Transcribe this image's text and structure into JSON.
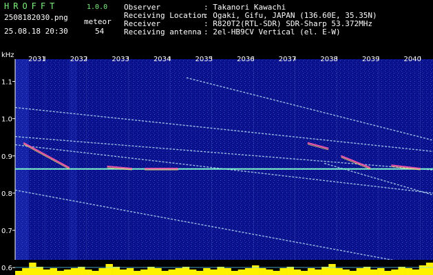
{
  "app": {
    "name": "HROFFT",
    "version": "1.0.0"
  },
  "file": {
    "name": "2508182030.png",
    "timestamp": "25.08.18 20:30"
  },
  "meteor": {
    "label": "meteor",
    "count": "54"
  },
  "info": [
    {
      "label": "Observer",
      "value": ": Takanori Kawachi"
    },
    {
      "label": "Receiving Location",
      "value": ": Ogaki, Gifu, JAPAN (136.60E, 35.35N)"
    },
    {
      "label": "Receiver",
      "value": ": R820T2(RTL-SDR) SDR-Sharp 53.372MHz"
    },
    {
      "label": "Receiving antenna",
      "value": ": 2el-HB9CV Vertical (el. E-W)"
    }
  ],
  "chart_data": {
    "type": "heatmap",
    "ylabel": "kHz",
    "x_ticks": [
      "2031",
      "2032",
      "2033",
      "2034",
      "2035",
      "2036",
      "2037",
      "2038",
      "2039",
      "2040"
    ],
    "y_ticks": [
      "1.1",
      "1.0",
      "0.9",
      "0.8",
      "0.7",
      "0.6"
    ],
    "ylim": [
      0.58,
      1.16
    ],
    "colors": {
      "background": "#0a0f8a",
      "grid": "#9bb6ff",
      "signal": "#c9f5ff",
      "bars": "#fff200",
      "text": "#ffffff"
    },
    "traces": [
      {
        "from": [
          0,
          1.03
        ],
        "to": [
          10,
          0.912
        ]
      },
      {
        "from": [
          0,
          0.952
        ],
        "to": [
          10,
          0.862
        ]
      },
      {
        "from": [
          0,
          0.93
        ],
        "to": [
          10,
          0.8
        ]
      },
      {
        "from": [
          0,
          0.808
        ],
        "to": [
          10,
          0.6
        ]
      },
      {
        "from": [
          4.1,
          1.11
        ],
        "to": [
          10,
          0.942
        ]
      },
      {
        "from": [
          7.4,
          0.88
        ],
        "to": [
          10,
          0.795
        ]
      }
    ],
    "carrier_khz": 0.865,
    "bursts": [
      {
        "from": [
          0.2,
          0.935
        ],
        "to": [
          1.3,
          0.868
        ]
      },
      {
        "from": [
          2.2,
          0.872
        ],
        "to": [
          2.8,
          0.866
        ]
      },
      {
        "from": [
          3.1,
          0.866
        ],
        "to": [
          3.9,
          0.866
        ]
      },
      {
        "from": [
          7.0,
          0.935
        ],
        "to": [
          7.5,
          0.92
        ]
      },
      {
        "from": [
          7.8,
          0.9
        ],
        "to": [
          8.5,
          0.868
        ]
      },
      {
        "from": [
          9.0,
          0.875
        ],
        "to": [
          9.7,
          0.866
        ]
      }
    ],
    "bar_levels": [
      0.3,
      0.5,
      0.9,
      0.6,
      0.4,
      0.5,
      0.3,
      0.4,
      0.5,
      0.6,
      0.4,
      0.3,
      0.5,
      0.8,
      0.6,
      0.4,
      0.5,
      0.3,
      0.4,
      0.6,
      0.5,
      0.3,
      0.4,
      0.5,
      0.6,
      0.4,
      0.3,
      0.5,
      0.4,
      0.6,
      0.5,
      0.3,
      0.4,
      0.5,
      0.7,
      0.5,
      0.4,
      0.3,
      0.5,
      0.6,
      0.4,
      0.3,
      0.5,
      0.4,
      0.6,
      0.8,
      0.5,
      0.4,
      0.3,
      0.5,
      0.6,
      0.4,
      0.5,
      0.3,
      0.4,
      0.6,
      0.5,
      0.4,
      0.7,
      0.9
    ]
  }
}
